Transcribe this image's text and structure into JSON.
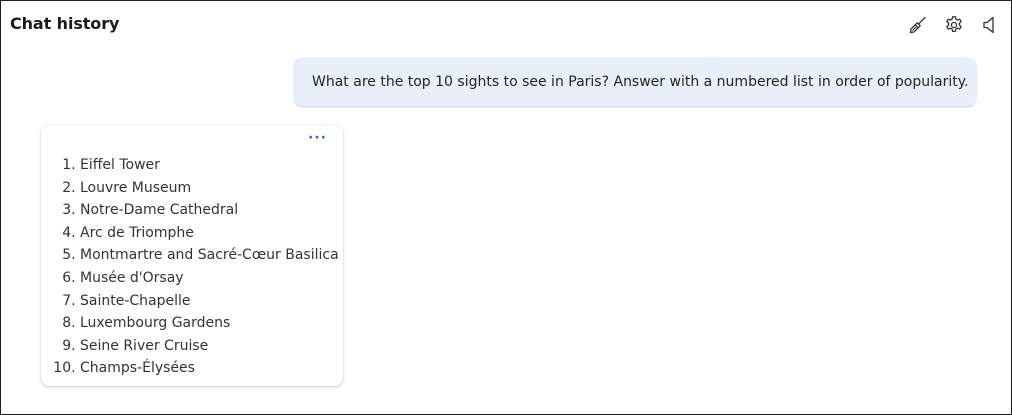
{
  "header": {
    "title": "Chat history",
    "icons": {
      "clear": "broom-icon",
      "settings": "gear-icon",
      "speaker": "speaker-icon"
    }
  },
  "conversation": {
    "user_message": "What are the top 10 sights to see in Paris? Answer with a numbered list in order of popularity.",
    "bot_response": {
      "more_label": "···",
      "items": [
        {
          "num": "1.",
          "text": "Eiffel Tower"
        },
        {
          "num": "2.",
          "text": "Louvre Museum"
        },
        {
          "num": "3.",
          "text": "Notre-Dame Cathedral"
        },
        {
          "num": "4.",
          "text": "Arc de Triomphe"
        },
        {
          "num": "5.",
          "text": "Montmartre and Sacré-Cœur Basilica"
        },
        {
          "num": "6.",
          "text": "Musée d'Orsay"
        },
        {
          "num": "7.",
          "text": "Sainte-Chapelle"
        },
        {
          "num": "8.",
          "text": "Luxembourg Gardens"
        },
        {
          "num": "9.",
          "text": "Seine River Cruise"
        },
        {
          "num": "10.",
          "text": "Champs-Élysées"
        }
      ]
    }
  },
  "colors": {
    "user_bubble": "#e8eefa",
    "accent": "#2f6fc2",
    "border": "#1f1f1f"
  }
}
